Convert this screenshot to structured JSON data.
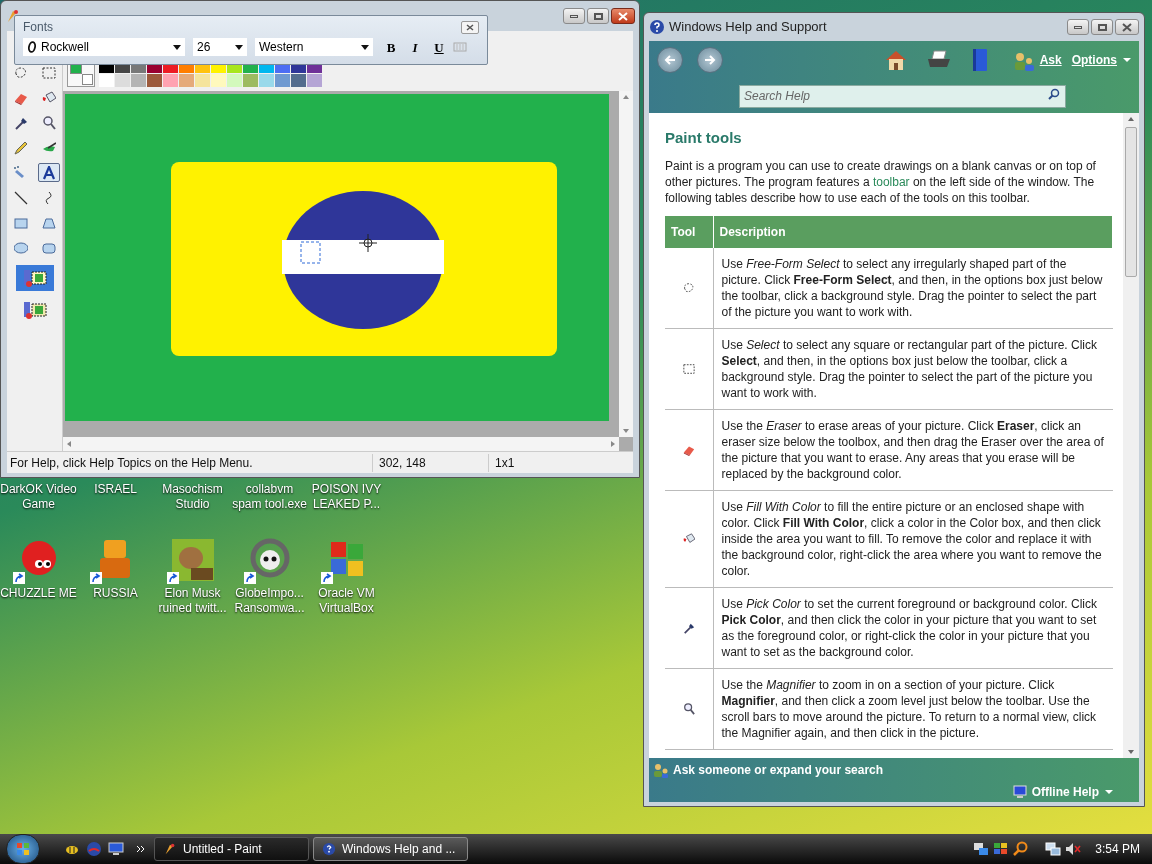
{
  "paint": {
    "tools": [
      {
        "kind": "lasso",
        "selected": false
      },
      {
        "kind": "select",
        "selected": false
      },
      {
        "kind": "eraser",
        "selected": false
      },
      {
        "kind": "fill",
        "selected": false
      },
      {
        "kind": "picker",
        "selected": false
      },
      {
        "kind": "magnifier",
        "selected": false
      },
      {
        "kind": "pencil",
        "selected": false
      },
      {
        "kind": "brush",
        "selected": false
      },
      {
        "kind": "airbrush",
        "selected": false
      },
      {
        "kind": "text",
        "selected": true
      },
      {
        "kind": "line",
        "selected": false
      },
      {
        "kind": "curve",
        "selected": false
      },
      {
        "kind": "rectangle",
        "selected": false
      },
      {
        "kind": "polygon",
        "selected": false
      },
      {
        "kind": "ellipse",
        "selected": false
      },
      {
        "kind": "rounded",
        "selected": false
      }
    ],
    "options": [
      {
        "selected": true
      },
      {
        "selected": false
      }
    ],
    "foreground": {
      "color": "#22b14c"
    },
    "background": {
      "color": "#ffffff"
    },
    "palette": [
      {
        "color": "#000000"
      },
      {
        "color": "#464646"
      },
      {
        "color": "#787878"
      },
      {
        "color": "#990030"
      },
      {
        "color": "#ed1c24"
      },
      {
        "color": "#ff7e00"
      },
      {
        "color": "#ffc20e"
      },
      {
        "color": "#fff200"
      },
      {
        "color": "#a8e61d"
      },
      {
        "color": "#22b14c"
      },
      {
        "color": "#00b7ef"
      },
      {
        "color": "#4d6df3"
      },
      {
        "color": "#2f3699"
      },
      {
        "color": "#6f3198"
      },
      {
        "color": "#ffffff"
      },
      {
        "color": "#dcdcdc"
      },
      {
        "color": "#b4b4b4"
      },
      {
        "color": "#9c5a3c"
      },
      {
        "color": "#ffa3b1"
      },
      {
        "color": "#e5aa7a"
      },
      {
        "color": "#f5e49c"
      },
      {
        "color": "#fff9bd"
      },
      {
        "color": "#d3f9bc"
      },
      {
        "color": "#9dbb61"
      },
      {
        "color": "#99d9ea"
      },
      {
        "color": "#709ad1"
      },
      {
        "color": "#546d8e"
      },
      {
        "color": "#b5a5d5"
      }
    ],
    "status_bar": {
      "help": "For Help, click Help Topics on the Help Menu.",
      "position": "302, 148",
      "size": "1x1"
    }
  },
  "fonts_toolbar": {
    "title": "Fonts",
    "font": "Rockwell",
    "size": "26",
    "script": "Western",
    "styles": [
      {
        "label": "B",
        "on": false
      },
      {
        "label": "I",
        "on": false
      },
      {
        "label": "U",
        "on": false
      }
    ]
  },
  "help": {
    "title": "Windows Help and Support",
    "ask": "Ask",
    "options": "Options",
    "search": {
      "placeholder": "Search Help"
    },
    "heading": "Paint tools",
    "intro": {
      "before": "Paint is a program you can use to create drawings on a blank canvas or on top of other pictures. The program features a ",
      "link": "toolbar",
      "after": " on the left side of the window. The following tables describe how to use each of the tools on this toolbar."
    },
    "table": {
      "columns": [
        "Tool",
        "Description"
      ],
      "rows": [
        {
          "kind": "lasso",
          "description": "Use *Free-Form Select* to select any irregularly shaped part of the picture. Click **Free-Form Select**, and then, in the options box just below the toolbar, click a background style. Drag the pointer to select the part of the picture you want to work with."
        },
        {
          "kind": "select",
          "description": "Use *Select* to select any square or rectangular part of the picture. Click **Select**, and then, in the options box just below the toolbar, click a background style. Drag the pointer to select the part of the picture you want to work with."
        },
        {
          "kind": "eraser",
          "description": "Use the *Eraser* to erase areas of your picture. Click **Eraser**, click an eraser size below the toolbox, and then drag the Eraser over the area of the picture that you want to erase. Any areas that you erase will be replaced by the background color."
        },
        {
          "kind": "fill",
          "description": "Use *Fill With Color* to fill the entire picture or an enclosed shape with color. Click **Fill With Color**, click a color in the Color box, and then click inside the area you want to fill. To remove the color and replace it with the background color, right-click the area where you want to remove the color."
        },
        {
          "kind": "picker",
          "description": "Use *Pick Color* to set the current foreground or background color. Click **Pick Color**, and then click the color in your picture that you want to set as the foreground color, or right-click the color in your picture that you want to set as the background color."
        },
        {
          "kind": "magnifier",
          "description": "Use the *Magnifier* to zoom in on a section of your picture. Click **Magnifier**, and then click a zoom level just below the toolbar. Use the scroll bars to move around the picture. To return to a normal view, click the Magnifier again, and then click in the picture."
        }
      ]
    },
    "footer": {
      "ask": "Ask someone or expand your search",
      "offline": "Offline Help"
    }
  },
  "desktop": {
    "covered_icons": [
      {
        "label": "DarkOK Video Game"
      },
      {
        "label": "ISRAEL"
      },
      {
        "label": "Masochism Studio"
      },
      {
        "label": "collabvm spam tool.exe"
      },
      {
        "label": "POISON IVY LEAKED P..."
      }
    ],
    "icons": [
      {
        "kind": "fuzzball",
        "label": "CHUZZLE ME"
      },
      {
        "kind": "blocks",
        "label": "RUSSIA"
      },
      {
        "kind": "box",
        "label": "Elon Musk ruined twitt..."
      },
      {
        "kind": "skull",
        "label": "GlobeImpo... Ransomwa..."
      },
      {
        "kind": "flag",
        "label": "Oracle VM VirtualBox"
      }
    ]
  },
  "taskbar": {
    "tasks": [
      {
        "kind": "paint",
        "label": "Untitled - Paint",
        "selected": false
      },
      {
        "kind": "help",
        "label": "Windows Help and ...",
        "selected": true
      }
    ],
    "clock": "3:54 PM"
  }
}
